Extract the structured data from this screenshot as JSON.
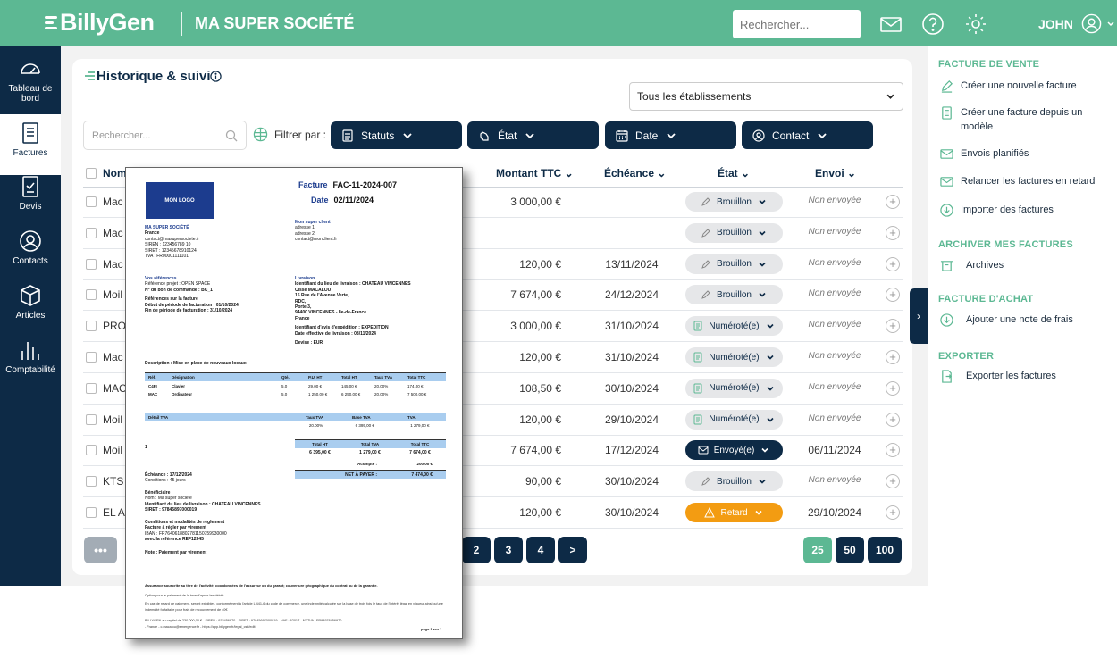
{
  "app": {
    "logo_text": "BillyGen",
    "company": "MA SUPER SOCIÉTÉ",
    "search_placeholder": "Rechercher...",
    "user": "JOHN"
  },
  "sidebar": [
    {
      "label": "Tableau de bord",
      "icon": "dashboard-icon"
    },
    {
      "label": "Factures",
      "icon": "invoice-icon",
      "active": true
    },
    {
      "label": "Devis",
      "icon": "quote-icon"
    },
    {
      "label": "Contacts",
      "icon": "contact-icon"
    },
    {
      "label": "Articles",
      "icon": "box-icon"
    },
    {
      "label": "Comptabilité",
      "icon": "chart-icon"
    }
  ],
  "main": {
    "title": "Historique & suivi",
    "establishment": "Tous les établissements",
    "search_placeholder": "Rechercher...",
    "filter_label": "Filtrer par :",
    "filters": [
      "Statuts",
      "État",
      "Date",
      "Contact"
    ],
    "columns": [
      "Nom",
      "Montant TTC",
      "Échéance",
      "État",
      "Envoi"
    ],
    "rows": [
      {
        "name": "Mac",
        "amount": "3 000,00 €",
        "due": "",
        "status": "Brouillon",
        "sent": "Non envoyée"
      },
      {
        "name": "Mac",
        "amount": "",
        "due": "",
        "status": "Brouillon",
        "sent": "Non envoyée"
      },
      {
        "name": "Mac",
        "amount": "120,00 €",
        "due": "13/11/2024",
        "status": "Brouillon",
        "sent": "Non envoyée"
      },
      {
        "name": "Moil",
        "amount": "7 674,00 €",
        "due": "24/12/2024",
        "status": "Brouillon",
        "sent": "Non envoyée"
      },
      {
        "name": "PRO",
        "amount": "3 000,00 €",
        "due": "31/10/2024",
        "status": "Numéroté(e)",
        "sent": "Non envoyée"
      },
      {
        "name": "Mac",
        "amount": "120,00 €",
        "due": "31/10/2024",
        "status": "Numéroté(e)",
        "sent": "Non envoyée"
      },
      {
        "name": "MAC",
        "amount": "108,50 €",
        "due": "30/10/2024",
        "status": "Numéroté(e)",
        "sent": "Non envoyée"
      },
      {
        "name": "Moil",
        "amount": "120,00 €",
        "due": "29/10/2024",
        "status": "Numéroté(e)",
        "sent": "Non envoyée"
      },
      {
        "name": "Moil",
        "amount": "7 674,00 €",
        "due": "17/12/2024",
        "status": "Envoyé(e)",
        "sent": "06/11/2024"
      },
      {
        "name": "KTS",
        "amount": "90,00 €",
        "due": "30/10/2024",
        "status": "Brouillon",
        "sent": "Non envoyée"
      },
      {
        "name": "EL A",
        "amount": "120,00 €",
        "due": "30/10/2024",
        "status": "Retard",
        "sent": "29/10/2024"
      }
    ],
    "pagination": {
      "dots": "•••",
      "pages": [
        "2",
        "3",
        "4"
      ],
      "next": ">",
      "sizes": [
        "25",
        "50",
        "100"
      ]
    }
  },
  "right_panel": {
    "sections": [
      {
        "title": "FACTURE DE VENTE",
        "actions": [
          "Créer une nouvelle facture",
          "Créer une facture depuis un modèle",
          "Envois planifiés",
          "Relancer les factures en retard",
          "Importer des factures"
        ]
      },
      {
        "title": "ARCHIVER MES FACTURES",
        "actions": [
          "Archives"
        ]
      },
      {
        "title": "FACTURE D'ACHAT",
        "actions": [
          "Ajouter une note de frais"
        ]
      },
      {
        "title": "EXPORTER",
        "actions": [
          "Exporter les factures"
        ]
      }
    ]
  },
  "preview": {
    "logo": "MON LOGO",
    "facture_label": "Facture",
    "facture_num": "FAC-11-2024-007",
    "date_label": "Date",
    "date": "02/11/2024",
    "seller": [
      "MA SUPER SOCIÉTÉ",
      "France",
      "contact@masupersociete.fr",
      "SIREN : 123456789 10",
      "SIRET : 12345678910124",
      "TVA : FR00001111101"
    ],
    "client": [
      "Mon super client",
      "adresse 1",
      "adresse 2",
      "contact@monclient.fr"
    ],
    "refs": [
      "Vos références",
      "Référence projet : OPEN SPACE",
      "N° du bon de commande : BC_1",
      "Références sur la facture",
      "Début de période de facturation : 01/10/2024",
      "Fin de période de facturation : 31/10/2024"
    ],
    "delivery": [
      "Livraison",
      "Identifiant du lieu de livraison : CHATEAU VINCENNES",
      "Cissé MACALOU",
      "15 Rue de l'Avenue Verte,",
      "RDC,",
      "Porte 3,",
      "94400 VINCENNES - Ile-de-France",
      "France",
      "Identifiant d'avis d'expédition : EXPEDITION",
      "Date effective de livraison : 08/11/2024",
      "Devise : EUR"
    ],
    "description": "Description : Mise en place de nouveaux locaux",
    "table_headers": [
      "Réf.",
      "Désignation",
      "Qté.",
      "P.U. HT",
      "Total HT",
      "Taux TVA",
      "Total TTC"
    ],
    "table_rows": [
      [
        "C4FI",
        "Clavier",
        "5.0",
        "29,00 €",
        "145,00 €",
        "20.00%",
        "174,00 €"
      ],
      [
        "MAC",
        "Ordinateur",
        "5.0",
        "1 250,00 €",
        "6 250,00 €",
        "20.00%",
        "7 500,00 €"
      ]
    ],
    "tva_headers": [
      "Détail TVA",
      "Taux TVA",
      "Base TVA",
      "TVA"
    ],
    "tva_row": [
      "",
      "20.00%",
      "6 395,00 €",
      "1 279,00 €"
    ],
    "totals_headers": [
      "Total HT",
      "Total TVA",
      "Total TTC"
    ],
    "totals_row": [
      "6 395,00 €",
      "1 279,00 €",
      "7 674,00 €"
    ],
    "acompte": "Acompte :",
    "acompte_val": "200,00 €",
    "net": "NET À PAYER :",
    "net_val": "7 474,00 €",
    "echeance": [
      "Échéance : 17/12/2024",
      "Conditions : 45 jours"
    ],
    "benef": [
      "Bénéficiaire",
      "Nom : Ma super société",
      "Identifiant du lieu de livraison : CHATEAU VINCENNES",
      "SIRET : 97845897000019"
    ],
    "cond": [
      "Conditions et modalités de règlement",
      "Facture à régler par virement",
      "IBAN : FR7640618802781150759930000",
      "avec la référence REF12345"
    ],
    "note": "Note : Paiement par virement",
    "footer": "Assurance souscrite au titre de l'activité; coordonnées de l'assureur ou du garant; couverture géographique du contrat ou de la garantie.",
    "page": "page 1 sur 1"
  }
}
